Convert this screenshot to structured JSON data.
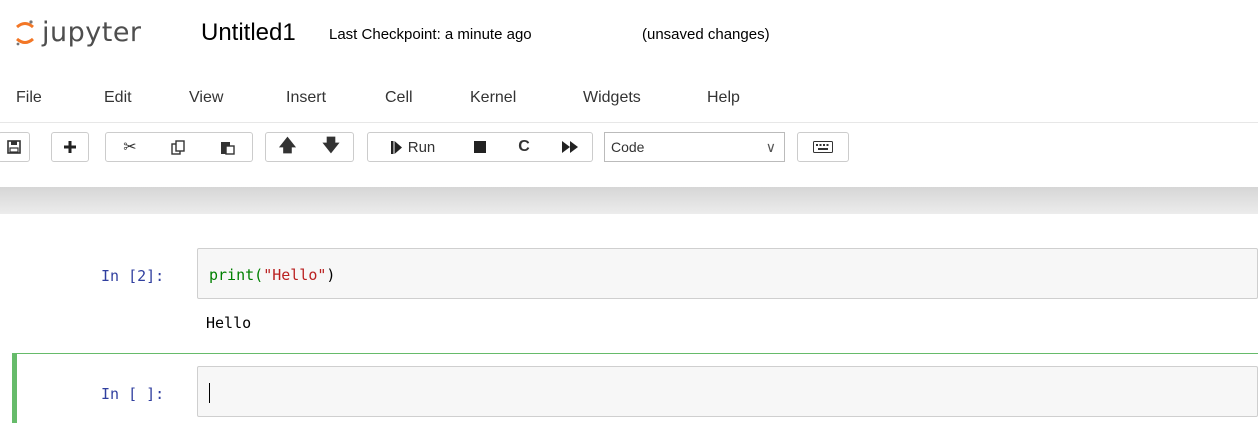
{
  "header": {
    "logo_text": "jupyter",
    "notebook_name": "Untitled1",
    "checkpoint": "Last Checkpoint: a minute ago",
    "autosave_status": "(unsaved changes)"
  },
  "menu": [
    "File",
    "Edit",
    "View",
    "Insert",
    "Cell",
    "Kernel",
    "Widgets",
    "Help"
  ],
  "toolbar": {
    "run_label": "Run",
    "cell_type": "Code",
    "icons": [
      "save-icon",
      "plus-icon",
      "cut-icon",
      "copy-icon",
      "paste-icon",
      "arrow-up-icon",
      "arrow-down-icon",
      "run-icon",
      "stop-icon",
      "restart-icon",
      "fast-forward-icon",
      "keyboard-icon"
    ]
  },
  "cells": [
    {
      "prompt": "In [2]:",
      "code_fn": "print(",
      "code_str": "\"Hello\"",
      "code_close": ")",
      "output": "Hello"
    },
    {
      "prompt": "In [ ]:",
      "code": ""
    }
  ],
  "colors": {
    "prompt": "#303f9f",
    "selected_cell_border": "#66bb6a",
    "builtin": "#008000",
    "string": "#ba2121"
  }
}
